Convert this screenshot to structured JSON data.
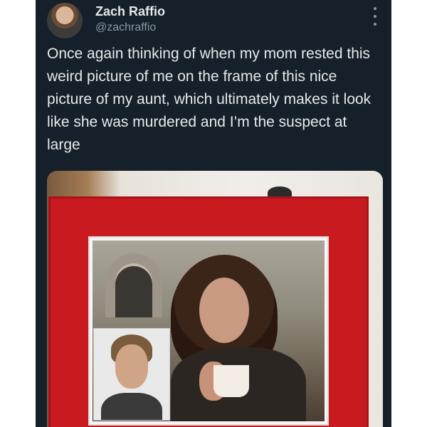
{
  "tweet": {
    "author_name": "Zach Raffio",
    "author_handle": "@zachraffio",
    "text": "Once again thinking of when my mom rested this weird picture of me on the frame of this nice picture of my aunt, which ultimately makes it look like she was murdered and I’m the suspect at large",
    "more_icon": "more-vertical-icon"
  },
  "colors": {
    "card_background": "#15202b",
    "text_primary": "#e7e9ea",
    "text_secondary": "#8b98a5",
    "frame_red": "#c81a1f"
  }
}
